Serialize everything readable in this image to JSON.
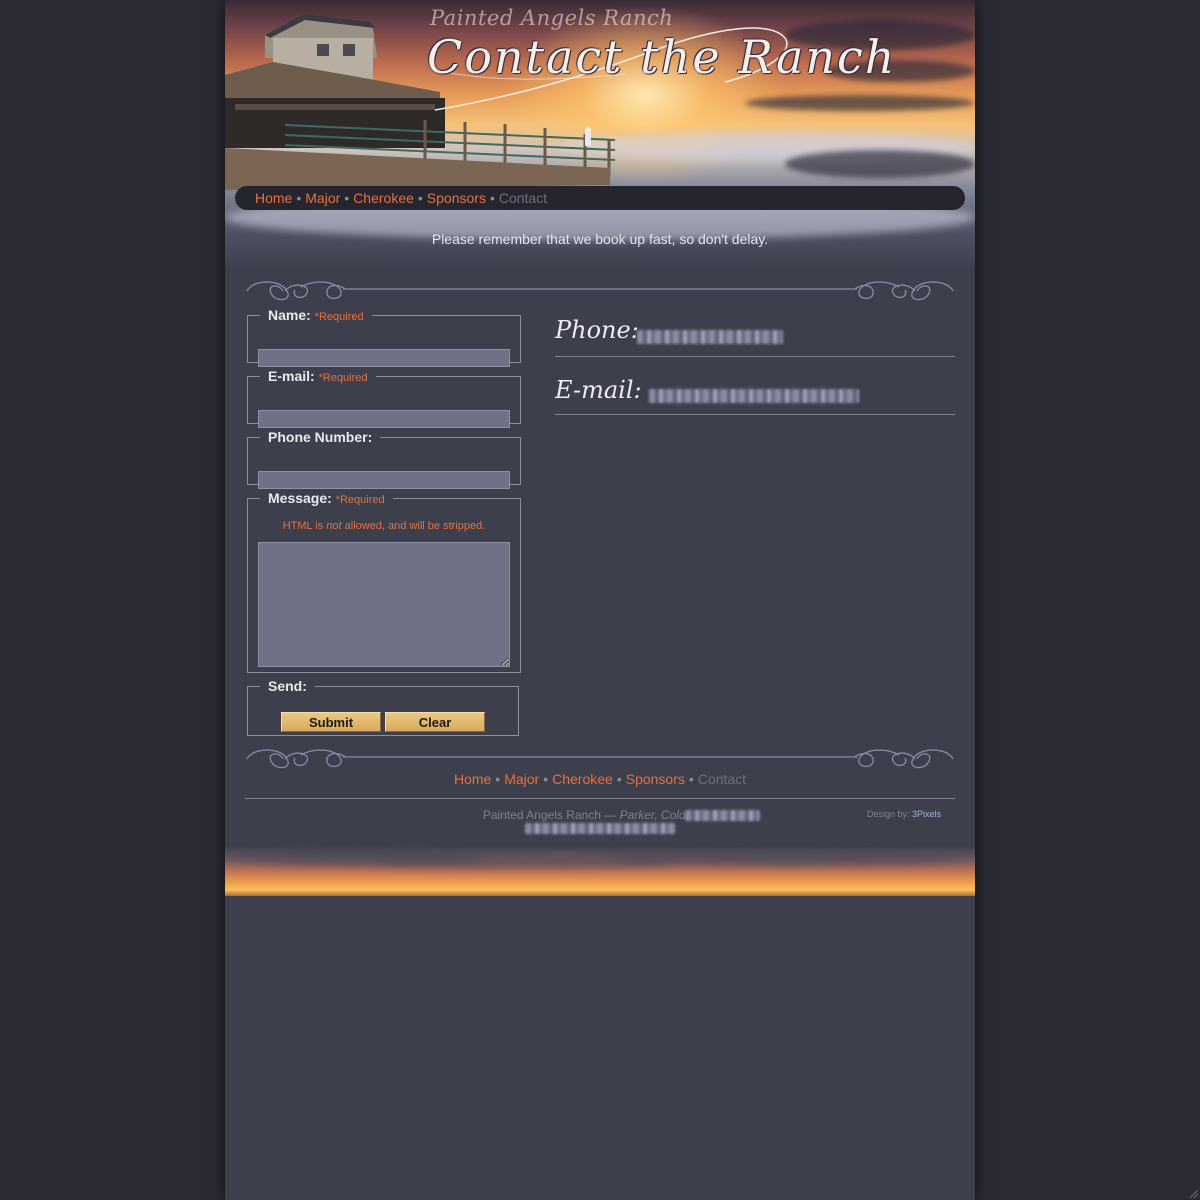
{
  "header": {
    "tagline": "Painted Angels Ranch",
    "title": "Contact the Ranch"
  },
  "nav": {
    "items": [
      {
        "label": "Home",
        "current": false
      },
      {
        "label": "Major",
        "current": false
      },
      {
        "label": "Cherokee",
        "current": false
      },
      {
        "label": "Sponsors",
        "current": false
      },
      {
        "label": "Contact",
        "current": true
      }
    ],
    "separator": "•"
  },
  "notice": "Please remember that we book up fast, so don't delay.",
  "form": {
    "name": {
      "label": "Name:",
      "required": "*Required",
      "value": ""
    },
    "email": {
      "label": "E-mail:",
      "required": "*Required",
      "value": ""
    },
    "phone": {
      "label": "Phone Number:",
      "value": ""
    },
    "message": {
      "label": "Message:",
      "required": "*Required",
      "note_pre": "HTML is ",
      "note_em": "not",
      "note_post": " allowed, and will be stripped.",
      "value": ""
    },
    "send": {
      "label": "Send:",
      "submit": "Submit",
      "clear": "Clear"
    }
  },
  "contact": {
    "phone_label": "Phone:",
    "email_label": "E-mail:"
  },
  "footer": {
    "ranch": "Painted Angels Ranch — ",
    "location": "Parker, Colorado",
    "dot": " •",
    "credit_prefix": "Design by: ",
    "credit_link": "3Pixels"
  },
  "colors": {
    "accent": "#e8703c",
    "page_bg": "#3d3f4c",
    "outer_bg": "#2a2b35",
    "input_bg": "#6f7287",
    "button": "#e0b46a"
  }
}
